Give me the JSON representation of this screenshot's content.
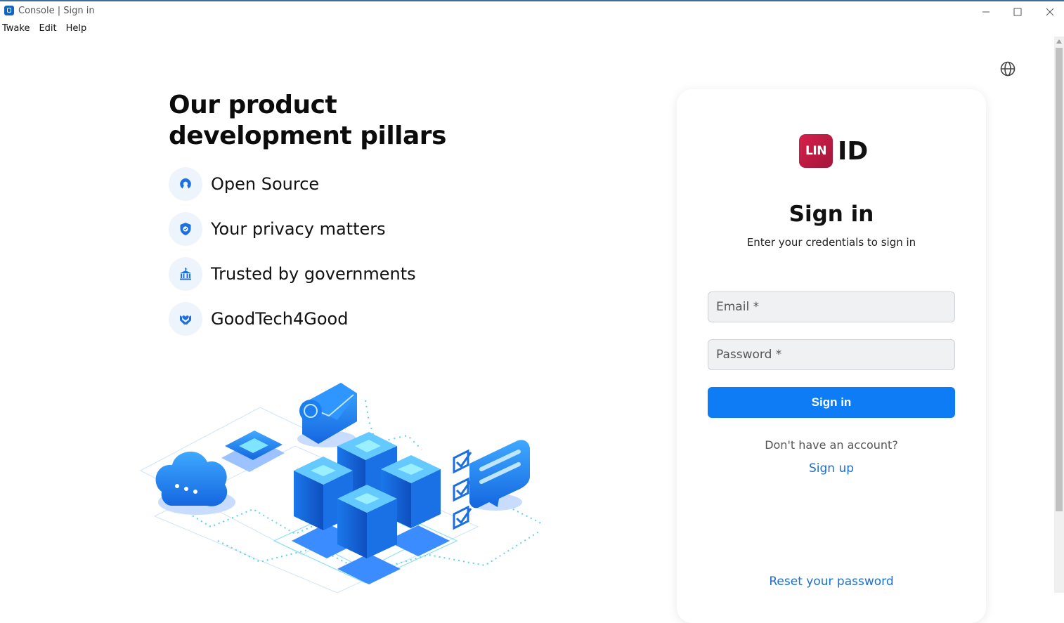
{
  "window": {
    "title": "Console | Sign in",
    "controls": [
      "minimize-icon",
      "maximize-icon",
      "close-icon"
    ]
  },
  "menu": [
    "Twake",
    "Edit",
    "Help"
  ],
  "left": {
    "headline_line1": "Our product",
    "headline_line2": "development pillars",
    "pillars": [
      {
        "icon": "open-source-icon",
        "label": "Open Source"
      },
      {
        "icon": "shield-icon",
        "label": "Your privacy matters"
      },
      {
        "icon": "government-icon",
        "label": "Trusted by governments"
      },
      {
        "icon": "hands-icon",
        "label": "GoodTech4Good"
      }
    ]
  },
  "card": {
    "logo_badge": "LIN",
    "logo_text": "ID",
    "title": "Sign in",
    "subtitle": "Enter your credentials to sign in",
    "email_placeholder": "Email *",
    "password_placeholder": "Password *",
    "submit_label": "Sign in",
    "no_account_text": "Don't have an account?",
    "signup_link": "Sign up",
    "reset_link": "Reset your password"
  },
  "colors": {
    "accent": "#0e7cf5",
    "link": "#1b6fd1",
    "brand": "#c41d45",
    "icon_blue": "#1d6fe0"
  }
}
